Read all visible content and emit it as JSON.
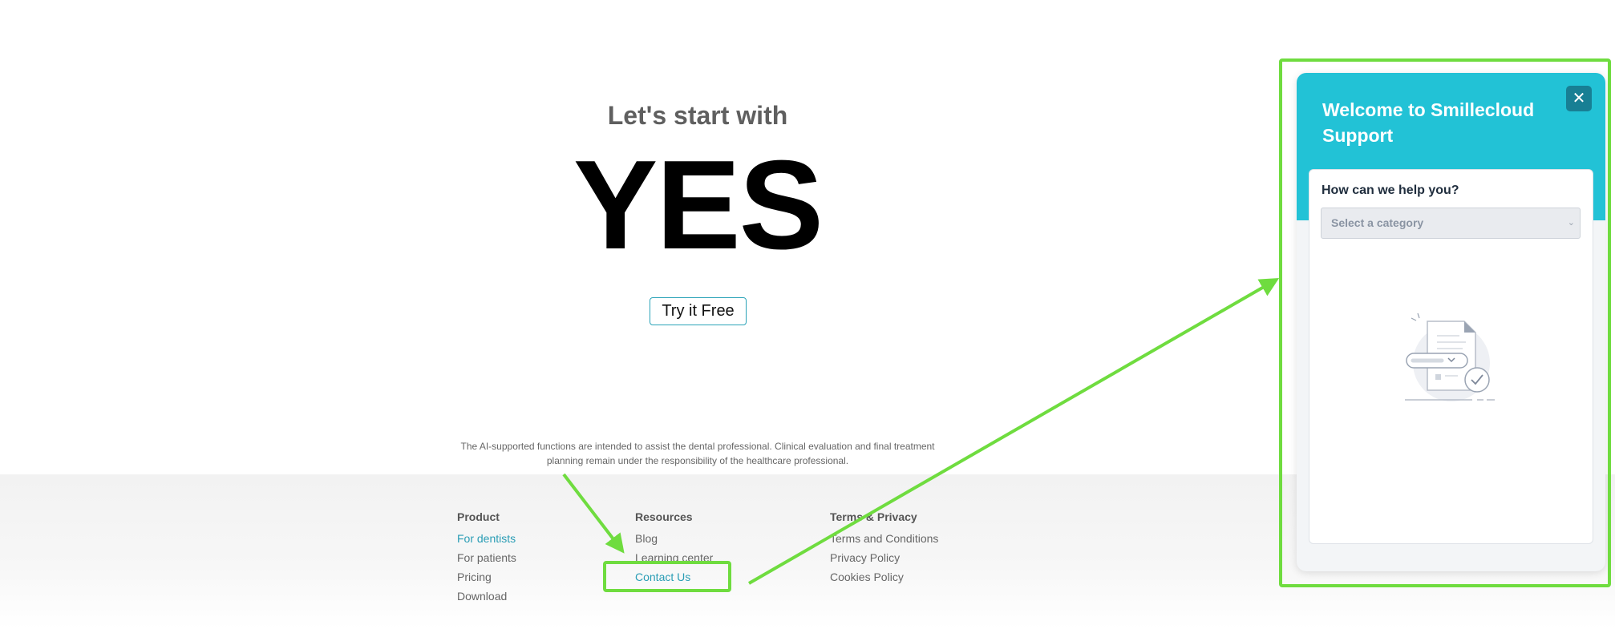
{
  "hero": {
    "subtitle": "Let's start with",
    "title": "YES",
    "cta_label": "Try it Free"
  },
  "disclaimer": "The AI-supported functions are intended to assist the dental professional. Clinical evaluation and final treatment planning remain under the responsibility of the healthcare professional.",
  "footer": {
    "product": {
      "heading": "Product",
      "links": [
        "For dentists",
        "For patients",
        "Pricing",
        "Download"
      ]
    },
    "resources": {
      "heading": "Resources",
      "links": [
        "Blog",
        "Learning center",
        "Contact Us"
      ]
    },
    "legal": {
      "heading": "Terms & Privacy",
      "links": [
        "Terms and Conditions",
        "Privacy Policy",
        "Cookies Policy"
      ]
    }
  },
  "widget": {
    "title": "Welcome to Smillecloud Support",
    "close_icon": "close-icon",
    "question": "How can we help you?",
    "select_placeholder": "Select a category",
    "illustration_icon": "document-checklist-icon"
  },
  "colors": {
    "accent": "#2a9db5",
    "widget_header": "#22c2d6",
    "widget_close": "#187f94",
    "annotation": "#6fdc3f"
  }
}
